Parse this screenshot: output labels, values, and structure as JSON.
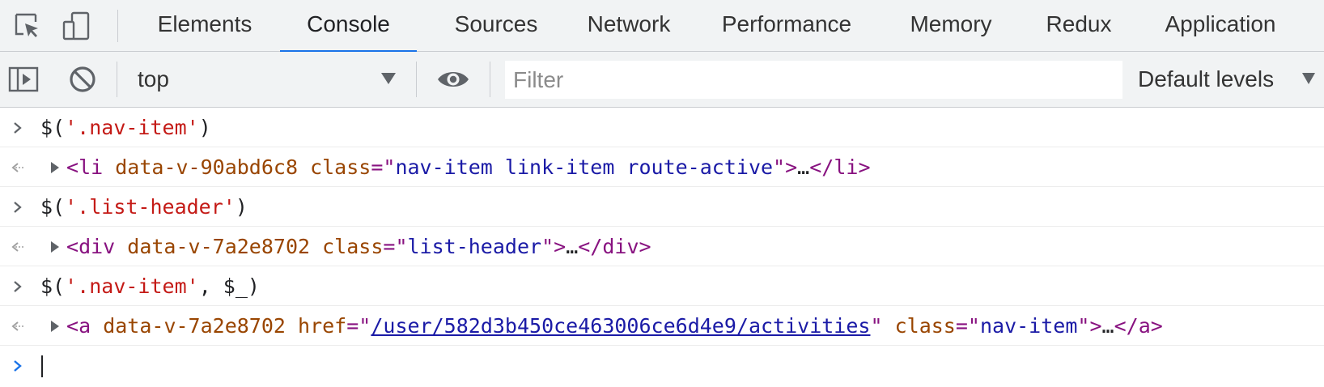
{
  "tabs": [
    {
      "label": "Elements"
    },
    {
      "label": "Console"
    },
    {
      "label": "Sources"
    },
    {
      "label": "Network"
    },
    {
      "label": "Performance"
    },
    {
      "label": "Memory"
    },
    {
      "label": "Redux"
    },
    {
      "label": "Application"
    }
  ],
  "active_tab": "Console",
  "toolbar": {
    "context": "top",
    "filter_placeholder": "Filter",
    "filter_value": "",
    "levels": "Default levels"
  },
  "icons": {
    "inspect": "inspect-element-icon",
    "device": "device-toolbar-icon",
    "sidebar": "show-sidebar-icon",
    "clear": "clear-console-icon",
    "live": "live-expression-eye-icon"
  },
  "console": {
    "entries": [
      {
        "type": "input",
        "parts": [
          "$(",
          "'.nav-item'",
          ")"
        ]
      },
      {
        "type": "result",
        "tag": "li",
        "attrs": [
          {
            "name": "data-v-90abd6c8"
          },
          {
            "name": "class",
            "value": "nav-item link-item route-active"
          }
        ],
        "ellipsis": "…"
      },
      {
        "type": "input",
        "parts": [
          "$(",
          "'.list-header'",
          ")"
        ]
      },
      {
        "type": "result",
        "tag": "div",
        "attrs": [
          {
            "name": "data-v-7a2e8702"
          },
          {
            "name": "class",
            "value": "list-header"
          }
        ],
        "ellipsis": "…"
      },
      {
        "type": "input",
        "parts": [
          "$(",
          "'.nav-item'",
          ", $_)"
        ]
      },
      {
        "type": "result",
        "tag": "a",
        "attrs": [
          {
            "name": "data-v-7a2e8702"
          },
          {
            "name": "href",
            "value": "/user/582d3b450ce463006ce6d4e9/activities"
          },
          {
            "name": "class",
            "value": "nav-item"
          }
        ],
        "ellipsis": "…"
      }
    ],
    "prompt_value": ""
  },
  "colors": {
    "toolbar_bg": "#f1f3f4",
    "accent": "#1a73e8",
    "string": "#c41a16",
    "tag": "#881280",
    "attr_name": "#994500",
    "attr_value": "#1a1aa6"
  }
}
